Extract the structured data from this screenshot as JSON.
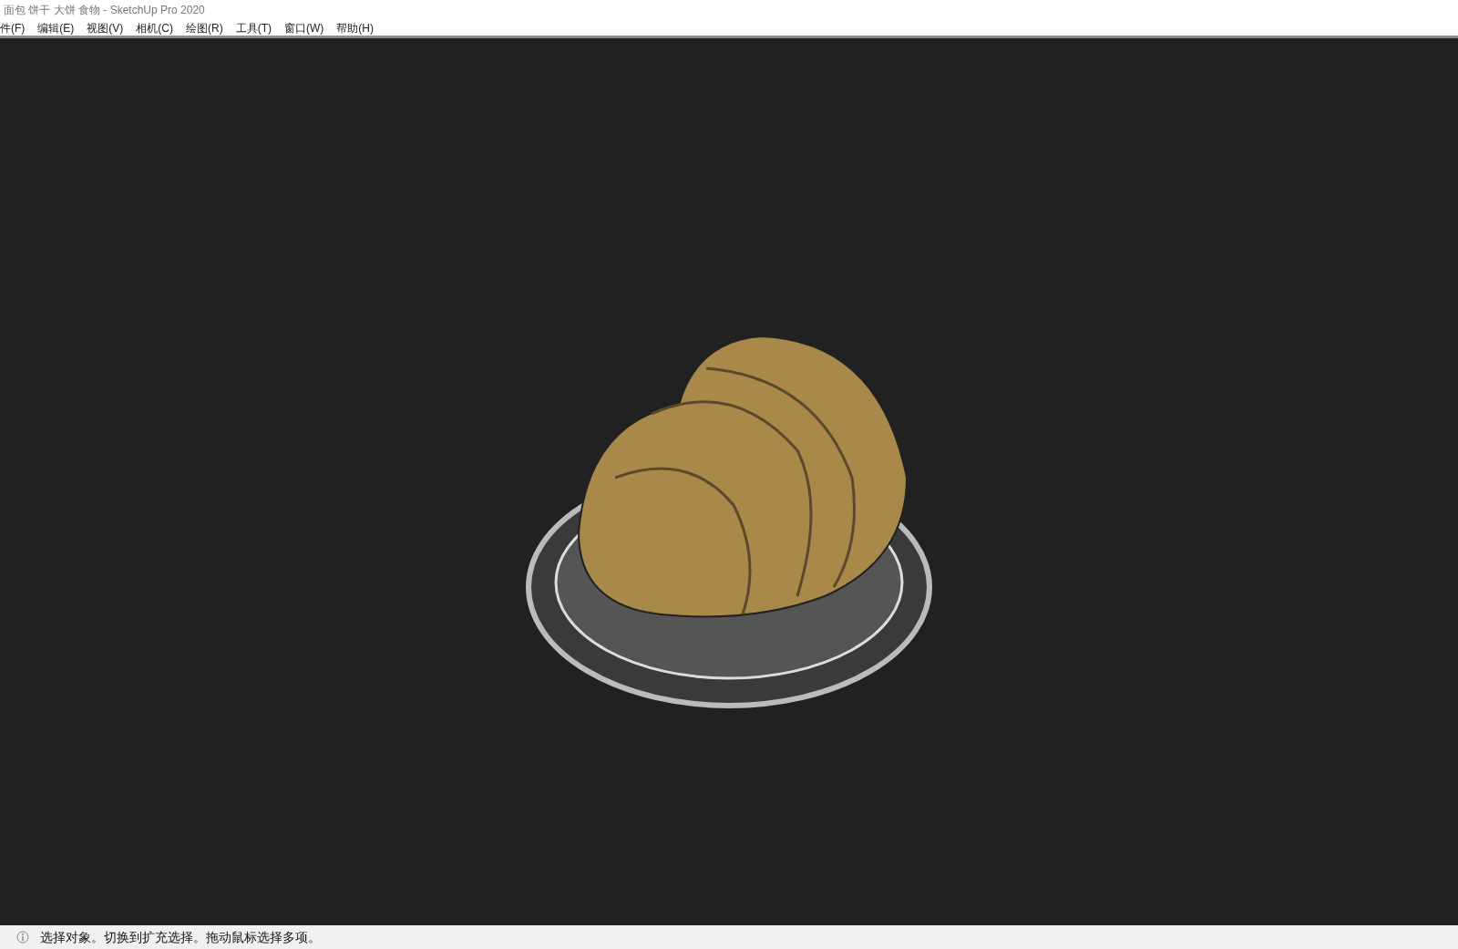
{
  "window": {
    "title": "面包 饼干 大饼 食物 - SketchUp Pro 2020"
  },
  "menu": [
    "件(F)",
    "编辑(E)",
    "视图(V)",
    "相机(C)",
    "绘图(R)",
    "工具(T)",
    "窗口(W)",
    "帮助(H)"
  ],
  "status_bar": {
    "message": "选择对象。切换到扩充选择。拖动鼠标选择多项。"
  }
}
